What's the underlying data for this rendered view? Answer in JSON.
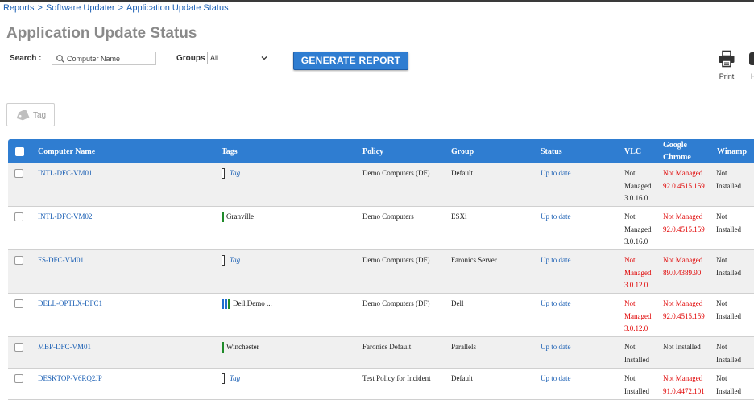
{
  "breadcrumb": [
    "Reports",
    "Software Updater",
    "Application Update Status"
  ],
  "breadcrumb_sep": ">",
  "page_title": "Application Update Status",
  "search": {
    "label": "Search :",
    "placeholder": "Computer Name"
  },
  "groups": {
    "label": "Groups",
    "selected": "All"
  },
  "generate_button": "GENERATE REPORT",
  "print_label": "Print",
  "help_label": "H",
  "tag_button": "Tag",
  "colors": {
    "header_blue": "#2f7dd1",
    "link_blue": "#1a5fb4",
    "red": "#e00000",
    "tag_green": "#1f8a2a",
    "tag_blue": "#1f6ed1"
  },
  "columns": [
    "Computer Name",
    "Tags",
    "Policy",
    "Group",
    "Status",
    "VLC",
    "Google Chrome",
    "Winamp"
  ],
  "rows": [
    {
      "name": "INTL-DFC-VM01",
      "tags": "Tag",
      "tag_type": "empty",
      "policy": "Demo Computers (DF)",
      "group": "Default",
      "status": "Up to date",
      "vlc": [
        "Not",
        "Managed",
        "3.0.16.0"
      ],
      "vlc_red": false,
      "chrome": [
        "Not Managed",
        "92.0.4515.159"
      ],
      "chrome_red": true,
      "winamp": [
        "Not",
        "Installed"
      ]
    },
    {
      "name": "INTL-DFC-VM02",
      "tags": "Granville",
      "tag_type": "green",
      "policy": "Demo Computers",
      "group": "ESXi",
      "status": "Up to date",
      "vlc": [
        "Not",
        "Managed",
        "3.0.16.0"
      ],
      "vlc_red": false,
      "chrome": [
        "Not Managed",
        "92.0.4515.159"
      ],
      "chrome_red": true,
      "winamp": [
        "Not",
        "Installed"
      ]
    },
    {
      "name": "FS-DFC-VM01",
      "tags": "Tag",
      "tag_type": "empty",
      "policy": "Demo Computers (DF)",
      "group": "Faronics Server",
      "status": "Up to date",
      "vlc": [
        "Not",
        "Managed",
        "3.0.12.0"
      ],
      "vlc_red": true,
      "chrome": [
        "Not Managed",
        "89.0.4389.90"
      ],
      "chrome_red": true,
      "winamp": [
        "Not",
        "Installed"
      ]
    },
    {
      "name": "DELL-OPTLX-DFC1",
      "tags": "Dell,Demo ...",
      "tag_type": "multi",
      "policy": "Demo Computers (DF)",
      "group": "Dell",
      "status": "Up to date",
      "vlc": [
        "Not",
        "Managed",
        "3.0.12.0"
      ],
      "vlc_red": true,
      "chrome": [
        "Not Managed",
        "92.0.4515.159"
      ],
      "chrome_red": true,
      "winamp": [
        "Not",
        "Installed"
      ]
    },
    {
      "name": "MBP-DFC-VM01",
      "tags": "Winchester",
      "tag_type": "green",
      "policy": "Faronics Default",
      "group": "Parallels",
      "status": "Up to date",
      "vlc": [
        "Not",
        "Installed"
      ],
      "vlc_red": false,
      "chrome": [
        "Not Installed"
      ],
      "chrome_red": false,
      "winamp": [
        "Not",
        "Installed"
      ]
    },
    {
      "name": "DESKTOP-V6RQ2JP",
      "tags": "Tag",
      "tag_type": "empty",
      "policy": "Test Policy for Incident",
      "group": "Default",
      "status": "Up to date",
      "vlc": [
        "Not",
        "Installed"
      ],
      "vlc_red": false,
      "chrome": [
        "Not Managed",
        "91.0.4472.101"
      ],
      "chrome_red": true,
      "winamp": [
        "Not",
        "Installed"
      ]
    }
  ]
}
